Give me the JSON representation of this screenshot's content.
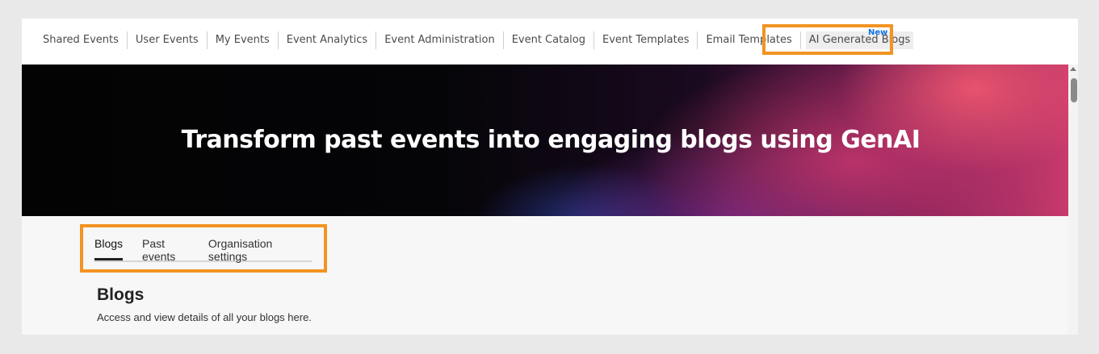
{
  "nav": {
    "items": [
      {
        "label": "Shared Events"
      },
      {
        "label": "User Events"
      },
      {
        "label": "My Events"
      },
      {
        "label": "Event Analytics"
      },
      {
        "label": "Event Administration"
      },
      {
        "label": "Event Catalog"
      },
      {
        "label": "Event Templates"
      },
      {
        "label": "Email Templates"
      },
      {
        "label": "AI Generated Blogs"
      }
    ],
    "new_badge": "New"
  },
  "hero": {
    "title": "Transform past events into engaging blogs using GenAI"
  },
  "tabs": [
    {
      "label": "Blogs",
      "active": true
    },
    {
      "label": "Past events",
      "active": false
    },
    {
      "label": "Organisation settings",
      "active": false
    }
  ],
  "section": {
    "title": "Blogs",
    "description": "Access and view details of all your blogs here."
  },
  "colors": {
    "highlight": "#f29423",
    "badge": "#1473e6"
  }
}
